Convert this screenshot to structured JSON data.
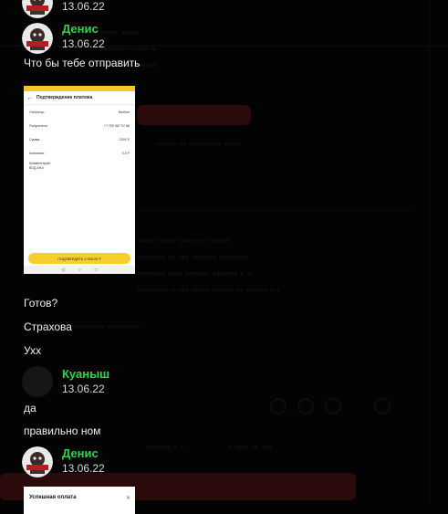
{
  "messages": [
    {
      "type": "header",
      "date": "13.06.22",
      "avatar": "skull-avatar"
    },
    {
      "type": "header",
      "sender": "Денис",
      "date": "13.06.22",
      "avatar": "skull-avatar"
    },
    {
      "type": "text",
      "text": "Что бы тебе отправить"
    },
    {
      "type": "text",
      "text": "Готов?"
    },
    {
      "type": "text",
      "text": "Страхова"
    },
    {
      "type": "text",
      "text": "Ухх"
    },
    {
      "type": "header",
      "sender": "Куаныш",
      "date": "13.06.22",
      "avatar": "blank-avatar"
    },
    {
      "type": "text",
      "text": "да"
    },
    {
      "type": "text",
      "text": "правильно ном"
    },
    {
      "type": "header",
      "sender": "Денис",
      "date": "13.06.22",
      "avatar": "skull-avatar"
    }
  ],
  "attachment_1": {
    "title": "Подтверждение платежа",
    "rows": [
      {
        "label": "Оператор:",
        "value": "Beeline"
      },
      {
        "label": "Получатель:",
        "value": "+7 705 587 57 86"
      },
      {
        "label": "Сумма",
        "value": "2000 ₸"
      },
      {
        "label": "Комиссия:",
        "value": "0,0 ₸"
      }
    ],
    "comment_label": "Комментарий:",
    "comment_value": "ВОД 4Ж4",
    "confirm_button": "ПОДТВЕРДИТЬ 2 000,00 ₸",
    "nav": [
      "◁",
      "○",
      "□"
    ]
  },
  "attachment_2": {
    "title": "Успешная оплата",
    "close": "✕"
  },
  "colors": {
    "background": "#030303",
    "sender_name": "#33d14f",
    "confirm_button": "#f7cf2c"
  }
}
